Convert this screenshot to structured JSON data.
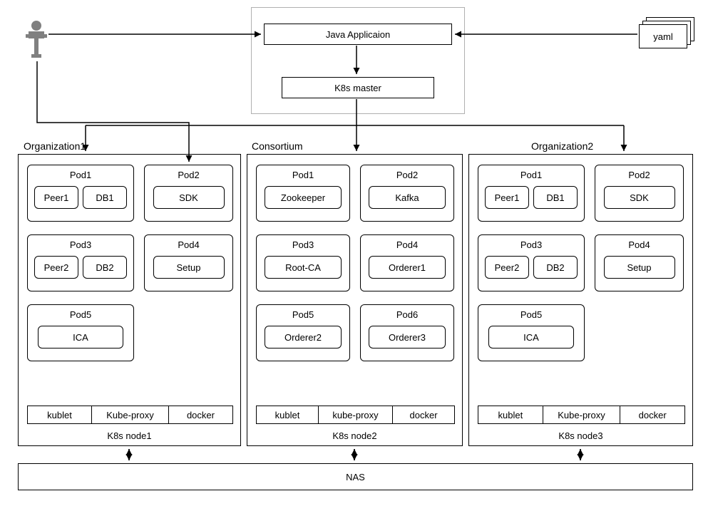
{
  "top": {
    "java_app": "Java Applicaion",
    "k8s_master": "K8s master",
    "yaml": "yaml"
  },
  "nodes": [
    {
      "title": "Organization1",
      "caption": "K8s node1",
      "pods": [
        {
          "name": "Pod1",
          "items": [
            "Peer1",
            "DB1"
          ]
        },
        {
          "name": "Pod2",
          "items": [
            "SDK"
          ]
        },
        {
          "name": "Pod3",
          "items": [
            "Peer2",
            "DB2"
          ]
        },
        {
          "name": "Pod4",
          "items": [
            "Setup"
          ]
        },
        {
          "name": "Pod5",
          "items": [
            "ICA"
          ]
        }
      ],
      "footer": [
        "kublet",
        "Kube-proxy",
        "docker"
      ]
    },
    {
      "title": "Consortium",
      "caption": "K8s node2",
      "pods": [
        {
          "name": "Pod1",
          "items": [
            "Zookeeper"
          ]
        },
        {
          "name": "Pod2",
          "items": [
            "Kafka"
          ]
        },
        {
          "name": "Pod3",
          "items": [
            "Root-CA"
          ]
        },
        {
          "name": "Pod4",
          "items": [
            "Orderer1"
          ]
        },
        {
          "name": "Pod5",
          "items": [
            "Orderer2"
          ]
        },
        {
          "name": "Pod6",
          "items": [
            "Orderer3"
          ]
        }
      ],
      "footer": [
        "kublet",
        "kube-proxy",
        "docker"
      ]
    },
    {
      "title": "Organization2",
      "caption": "K8s node3",
      "pods": [
        {
          "name": "Pod1",
          "items": [
            "Peer1",
            "DB1"
          ]
        },
        {
          "name": "Pod2",
          "items": [
            "SDK"
          ]
        },
        {
          "name": "Pod3",
          "items": [
            "Peer2",
            "DB2"
          ]
        },
        {
          "name": "Pod4",
          "items": [
            "Setup"
          ]
        },
        {
          "name": "Pod5",
          "items": [
            "ICA"
          ]
        }
      ],
      "footer": [
        "kublet",
        "Kube-proxy",
        "docker"
      ]
    }
  ],
  "nas": "NAS"
}
